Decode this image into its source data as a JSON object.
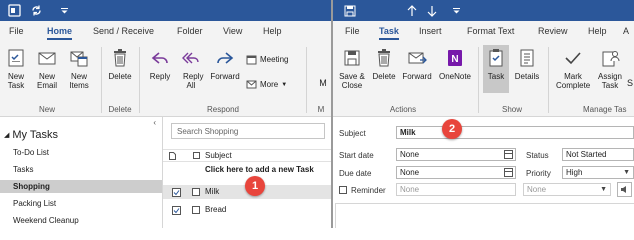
{
  "left": {
    "menu": [
      "File",
      "Home",
      "Send / Receive",
      "Folder",
      "View",
      "Help"
    ],
    "active_menu": "Home",
    "ribbon": {
      "new_task": "New Task",
      "new_email": "New Email",
      "new_items": "New Items",
      "delete": "Delete",
      "reply": "Reply",
      "reply_all": "Reply All",
      "forward": "Forward",
      "meeting": "Meeting",
      "more": "More",
      "overflow": "M",
      "groups": {
        "new": "New",
        "delete": "Delete",
        "respond": "Respond",
        "overflow": "M"
      }
    },
    "nav": {
      "heading": "My Tasks",
      "items": [
        "To-Do List",
        "Tasks",
        "Shopping",
        "Packing List",
        "Weekend Cleanup"
      ],
      "selected": "Shopping"
    },
    "tasklist": {
      "search_placeholder": "Search Shopping",
      "column_subject": "Subject",
      "new_task_prompt": "Click here to add a new Task",
      "rows": [
        "Milk",
        "Bread"
      ]
    },
    "badge": "1"
  },
  "right": {
    "menu": [
      "File",
      "Task",
      "Insert",
      "Format Text",
      "Review",
      "Help",
      "A"
    ],
    "active_menu": "Task",
    "ribbon": {
      "save_close": "Save & Close",
      "delete": "Delete",
      "forward": "Forward",
      "onenote": "OneNote",
      "task": "Task",
      "details": "Details",
      "mark_complete": "Mark Complete",
      "assign_task": "Assign Task",
      "overflow": "S",
      "groups": {
        "actions": "Actions",
        "show": "Show",
        "manage": "Manage Tas"
      }
    },
    "form": {
      "subject_label": "Subject",
      "subject_value": "Milk",
      "start_date_label": "Start date",
      "start_date_value": "None",
      "due_date_label": "Due date",
      "due_date_value": "None",
      "status_label": "Status",
      "status_value": "Not Started",
      "priority_label": "Priority",
      "priority_value": "High",
      "reminder_label": "Reminder",
      "reminder_date": "None",
      "reminder_time": "None"
    },
    "badge": "2"
  },
  "colors": {
    "titlebar": "#2b579a",
    "accent": "#2b579a",
    "badge": "#e8453c",
    "selected_nav": "#cdcdcd"
  }
}
